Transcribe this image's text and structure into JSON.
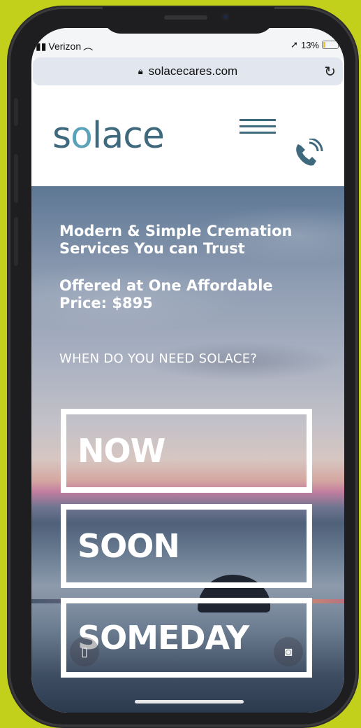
{
  "status_bar": {
    "carrier": "Verizon",
    "battery": "13%"
  },
  "browser": {
    "url": "solacecares.com"
  },
  "site": {
    "logo_text": "solace",
    "headline_1": "Modern & Simple Cremation Services You can Trust",
    "headline_2": "Offered at One Affordable Price: $895",
    "question": "WHEN DO YOU NEED SOLACE?",
    "buttons": [
      "NOW",
      "SOON",
      "SOMEDAY"
    ]
  },
  "colors": {
    "background": "#c3d01b",
    "logo": "#3f6a7e",
    "accent": "#5aa3b8"
  },
  "icons": [
    "signal-icon",
    "wifi-icon",
    "location-icon",
    "battery-icon",
    "lock-icon",
    "reload-icon",
    "menu-icon",
    "phone-icon",
    "flashlight-icon",
    "camera-icon"
  ]
}
